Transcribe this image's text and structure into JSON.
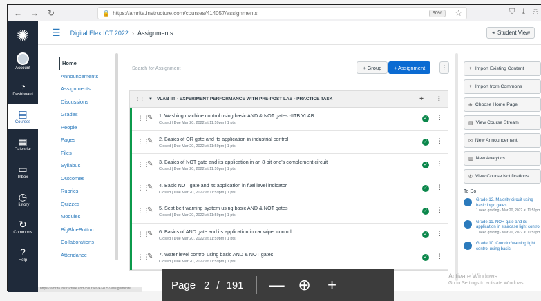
{
  "browser": {
    "url": "https://amrita.instructure.com/courses/414057/assignments",
    "zoom": "90%"
  },
  "global_nav": {
    "items": [
      {
        "label": "Account"
      },
      {
        "label": "Dashboard"
      },
      {
        "label": "Courses"
      },
      {
        "label": "Calendar"
      },
      {
        "label": "Inbox"
      },
      {
        "label": "History"
      },
      {
        "label": "Commons"
      },
      {
        "label": "Help"
      }
    ]
  },
  "breadcrumb": {
    "course": "Digital Elex ICT 2022",
    "separator": "›",
    "current": "Assignments"
  },
  "header": {
    "student_view": "Student View"
  },
  "course_nav": [
    "Home",
    "Announcements",
    "Assignments",
    "Discussions",
    "Grades",
    "People",
    "Pages",
    "Files",
    "Syllabus",
    "Outcomes",
    "Rubrics",
    "Quizzes",
    "Modules",
    "BigBlueButton",
    "Collaborations",
    "Attendance"
  ],
  "toolbar": {
    "search_placeholder": "Search for Assignment",
    "group_label": "+ Group",
    "assignment_label": "+ Assignment"
  },
  "module": {
    "title": "VLAB IIT - EXPERIMENT PERFORMANCE WITH PRE-POST LAB - PRACTICE TASK",
    "items": [
      {
        "title": "1. Washing machine control using basic AND & NOT gates -IITB VLAB",
        "meta": "Closed  |  Due Mar 20, 2022 at 11:59pm  |  1 pts"
      },
      {
        "title": "2. Basics of OR gate and its application in industrial control",
        "meta": "Closed  |  Due Mar 20, 2022 at 11:59pm  |  1 pts"
      },
      {
        "title": "3. Basics of NOT gate and its application in an 8-bit one's complement circuit",
        "meta": "Closed  |  Due Mar 20, 2022 at 11:59pm  |  1 pts"
      },
      {
        "title": "4. Basic NOT gate and its application in fuel level indicator",
        "meta": "Closed  |  Due Mar 20, 2022 at 11:59pm  |  1 pts"
      },
      {
        "title": "5. Seat belt warning system using basic AND & NOT gates",
        "meta": "Closed  |  Due Mar 20, 2022 at 11:59pm  |  1 pts"
      },
      {
        "title": "6. Basics of AND gate and its application in car wiper control",
        "meta": "Closed  |  Due Mar 20, 2022 at 11:59pm  |  1 pts"
      },
      {
        "title": "7. Water level control using basic AND & NOT gates",
        "meta": "Closed  |  Due Mar 20, 2022 at 11:59pm  |  1 pts"
      }
    ]
  },
  "sidebar": {
    "buttons": [
      {
        "icon": "⇪",
        "label": "Import Existing Content"
      },
      {
        "icon": "⇪",
        "label": "Import from Commons"
      },
      {
        "icon": "⊕",
        "label": "Choose Home Page"
      },
      {
        "icon": "▤",
        "label": "View Course Stream"
      },
      {
        "icon": "✉",
        "label": "New Announcement"
      },
      {
        "icon": "▥",
        "label": "New Analytics"
      },
      {
        "icon": "✆",
        "label": "View Course Notifications"
      }
    ],
    "todo_heading": "To Do",
    "todos": [
      {
        "title": "Grade 12. Majority circuit using basic logic gates",
        "sub": "1 need grading · Mar 20, 2022 at 11:59pm"
      },
      {
        "title": "Grade 11. NOR gate and its application in staircase light control",
        "sub": "1 need grading · Mar 20, 2022 at 11:59pm"
      },
      {
        "title": "Grade 10. Corridor/warning light control using basic",
        "sub": ""
      }
    ]
  },
  "watermark": {
    "line1": "Activate Windows",
    "line2": "Go to Settings to activate Windows."
  },
  "status_url": "https://amrita.instructure.com/courses/414057/assignments",
  "pdf_toolbar": {
    "page_label": "Page",
    "page_number": "2",
    "separator": "/",
    "total_pages": "191",
    "zoom_out": "—",
    "zoom_icon": "⊕",
    "zoom_in": "+"
  }
}
